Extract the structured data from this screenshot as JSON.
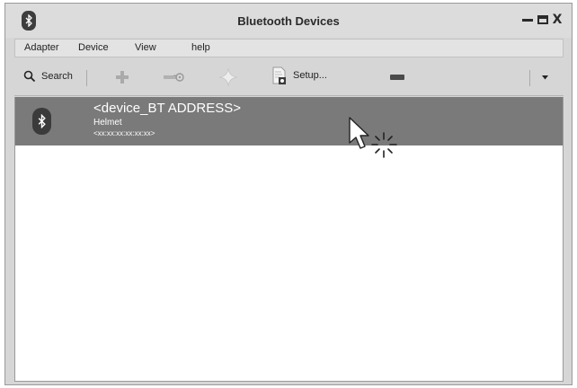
{
  "window": {
    "title": "Bluetooth Devices",
    "app_icon": "bluetooth-icon",
    "controls": {
      "minimize": "minimize-icon",
      "maximize": "maximize-icon",
      "close": "X"
    }
  },
  "menu": [
    "Adapter",
    "Device",
    "View",
    "help"
  ],
  "toolbar": {
    "search_label": "Search",
    "setup_label": "Setup...",
    "icons": [
      "search-icon",
      "add-icon",
      "key-icon",
      "trust-star-icon",
      "setup-document-icon",
      "remove-icon",
      "dropdown-arrow-icon"
    ]
  },
  "devices": [
    {
      "address": "<device_BT ADDRESS>",
      "name": "Helmet",
      "mac": "<xx:xx:xx:xx:xx:xx>",
      "icon": "bluetooth-icon",
      "selected": true
    }
  ],
  "colors": {
    "selection": "#7a7a7a",
    "window_bg": "#d6d6d6",
    "list_bg": "#ffffff"
  }
}
